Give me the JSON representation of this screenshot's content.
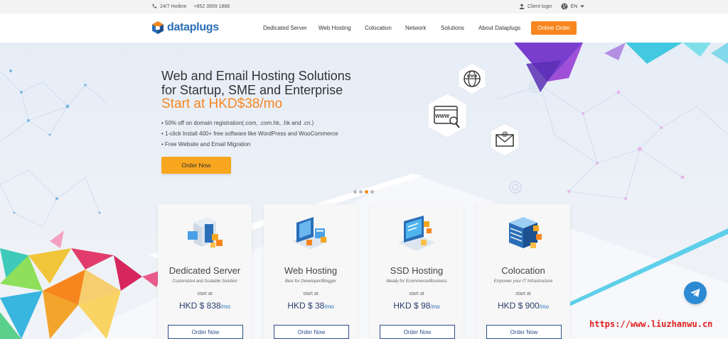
{
  "topbar": {
    "hotline_label": "24/7 Hotline",
    "hotline_number": "+852 3959 1888",
    "client_login": "Client login",
    "language": "EN"
  },
  "nav": {
    "logo_text": "dataplugs",
    "items": [
      "Dedicated Server",
      "Web Hosting",
      "Colocation",
      "Network",
      "Solutions",
      "About Dataplugs"
    ],
    "cta": "Online Order"
  },
  "hero": {
    "headline_line1": "Web and Email Hosting Solutions",
    "headline_line2": "for Startup, SME and Enterprise",
    "price_line": "Start at HKD$38/mo",
    "bullets": [
      "• 50% off on domain registration(.com, .com.hk, .hk and .cn.)",
      "• 1-click Install 400+ free software like WordPress and WooCommerce",
      "• Free Website and Email Migration"
    ],
    "order_button": "Order Now",
    "slide_count": 4,
    "active_slide": 3,
    "bubble_labels": [
      "WWW",
      "WWW",
      "@"
    ]
  },
  "cards": [
    {
      "title": "Dedicated Server",
      "subtitle": "Customized and Scalable Solution",
      "start_at": "start at",
      "price": "HKD $ 838",
      "unit": "/mo",
      "button": "Order Now"
    },
    {
      "title": "Web Hosting",
      "subtitle": "Best for Developer/Blogger",
      "start_at": "start at",
      "price": "HKD $ 38",
      "unit": "/mo",
      "button": "Order Now"
    },
    {
      "title": "SSD Hosting",
      "subtitle": "Ideally for Ecommerce/Business",
      "start_at": "start at",
      "price": "HKD $ 98",
      "unit": "/mo",
      "button": "Order Now"
    },
    {
      "title": "Colocation",
      "subtitle": "Empower your IT Infrastructure",
      "start_at": "start at",
      "price": "HKD $ 900",
      "unit": "/mo",
      "button": "Order Now"
    }
  ],
  "watermark": "https://www.liuzhanwu.cn",
  "colors": {
    "accent": "#f7861e",
    "brand": "#2a6eb7",
    "button_yellow": "#f7a61e",
    "telegram": "#2d8bd3",
    "watermark": "#e02020"
  },
  "icons": [
    "phone-icon",
    "user-icon",
    "globe-icon",
    "caret-down-icon",
    "telegram-icon",
    "www-globe-icon",
    "browser-www-icon",
    "email-icon"
  ]
}
